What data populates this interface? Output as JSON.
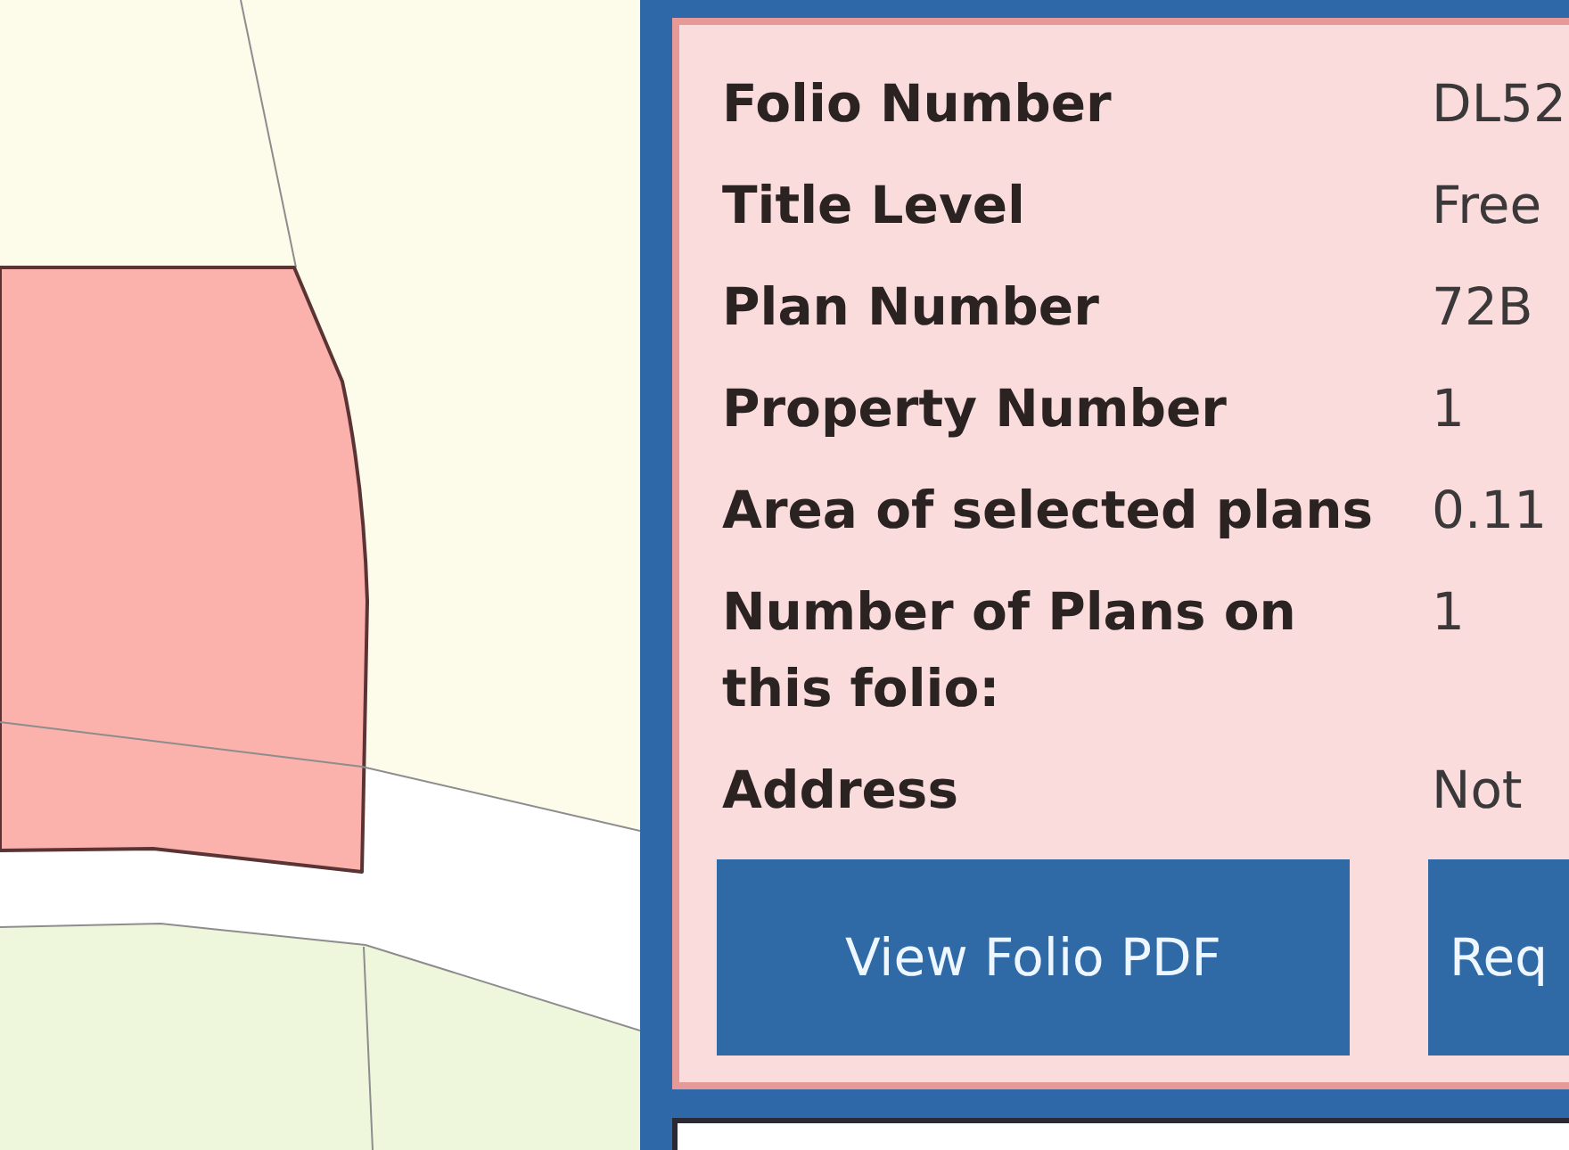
{
  "details": [
    {
      "label": "Folio Number",
      "value": "DL52"
    },
    {
      "label": "Title Level",
      "value": "Free"
    },
    {
      "label": "Plan Number",
      "value": "72B"
    },
    {
      "label": "Property Number",
      "value": "1"
    },
    {
      "label": "Area of selected plans",
      "value": "0.11"
    },
    {
      "label": "Number of Plans on this folio:",
      "value": "1"
    },
    {
      "label": "Address",
      "value": "Not"
    }
  ],
  "buttons": [
    {
      "label": "View Folio PDF"
    },
    {
      "label": "Req"
    }
  ]
}
